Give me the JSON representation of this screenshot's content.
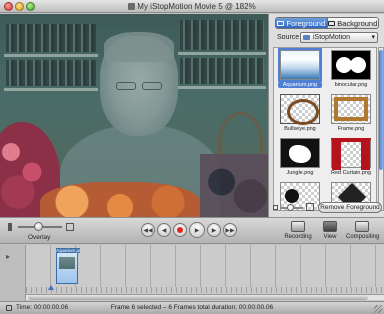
{
  "window": {
    "title": "My iStopMotion Movie 5 @ 182%"
  },
  "panel": {
    "tabs": [
      {
        "label": "Foreground",
        "active": true
      },
      {
        "label": "Background",
        "active": false
      }
    ],
    "source_label": "Source",
    "source_value": "iStopMotion",
    "thumbnails": [
      {
        "label": "Aquarium.png",
        "selected": true
      },
      {
        "label": "binocular.png",
        "selected": false
      },
      {
        "label": "Bullseye.png",
        "selected": false
      },
      {
        "label": "Frame.png",
        "selected": false
      },
      {
        "label": "Jungle.png",
        "selected": false
      },
      {
        "label": "Red Curtain.png",
        "selected": false
      }
    ],
    "remove_button": "Remove Foreground"
  },
  "toolbar": {
    "overlay_label": "Overlay",
    "recording_label": "Recording",
    "view_label": "View",
    "compositing_label": "Compositing"
  },
  "timeline": {
    "frame_label": "Aquarium.png"
  },
  "status": {
    "time": "Time: 00:00:00.06",
    "message": "Frame 6 selected – 6 Frames total duration: 00:00:00.06"
  },
  "colors": {
    "selection_blue": "#4f7fd5",
    "record_red": "#e0261f"
  }
}
